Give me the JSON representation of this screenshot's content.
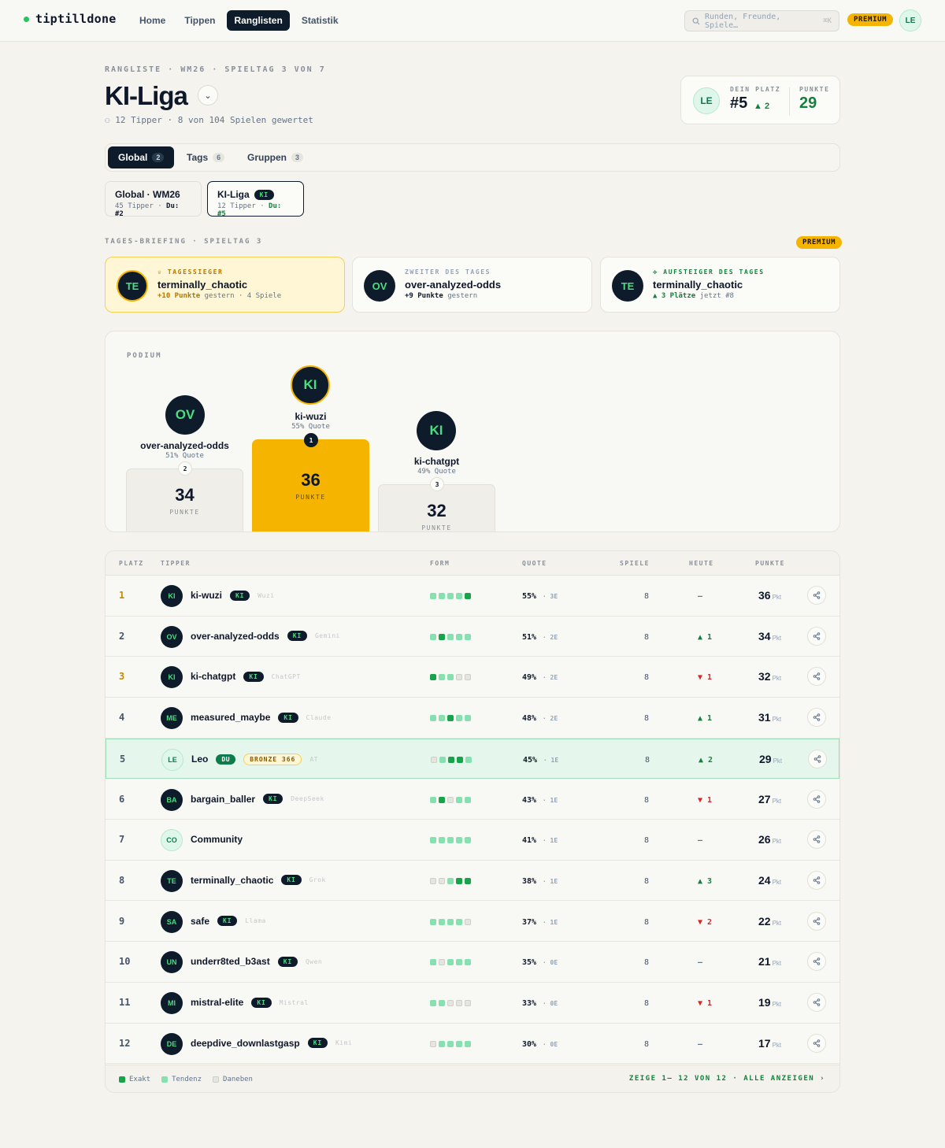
{
  "colors": {
    "accent": "#0d1b2a",
    "gold": "#f4b400",
    "green": "#15803d",
    "exact": "#16a34a",
    "tendency": "#86e0b0"
  },
  "header": {
    "logo": "tiptilldone",
    "nav": [
      "Home",
      "Tippen",
      "Ranglisten",
      "Statistik"
    ],
    "active_nav": "Ranglisten",
    "search_placeholder": "Runden, Freunde, Spiele…",
    "search_kbd": "⌘K",
    "premium": "PREMIUM",
    "user_initials": "LE"
  },
  "page": {
    "breadcrumb": "RANGLISTE · WM26 · SPIELTAG 3 VON 7",
    "title": "KI-Liga",
    "subtitle": "12 Tipper · 8 von 104 Spielen gewertet"
  },
  "rank_card": {
    "initials": "LE",
    "place_label": "DEIN PLATZ",
    "place": "#5",
    "delta": "▲ 2",
    "points_label": "PUNKTE",
    "points": "29"
  },
  "tabs": [
    {
      "label": "Global",
      "count": "2"
    },
    {
      "label": "Tags",
      "count": "6"
    },
    {
      "label": "Gruppen",
      "count": "3"
    }
  ],
  "leagues": [
    {
      "name": "Global · WM26",
      "tag": "",
      "tipper": "45 Tipper",
      "you": "Du: #2"
    },
    {
      "name": "KI-Liga",
      "tag": "KI",
      "tipper": "12 Tipper",
      "you": "Du: #5"
    }
  ],
  "briefing": {
    "label": "TAGES-BRIEFING · SPIELTAG 3",
    "premium": "PREMIUM",
    "cards": [
      {
        "kicker": "♕ TAGESSIEGER",
        "initials": "TE",
        "name": "terminally_chaotic",
        "bold": "+10 Punkte",
        "rest": "gestern · 4 Spiele"
      },
      {
        "kicker": "ZWEITER DES TAGES",
        "initials": "OV",
        "name": "over-analyzed-odds",
        "bold": "+9 Punkte",
        "rest": "gestern"
      },
      {
        "kicker": "⟡ AUFSTEIGER DES TAGES",
        "initials": "TE",
        "name": "terminally_chaotic",
        "bold": "▲ 3 Plätze",
        "rest": "jetzt #8"
      }
    ]
  },
  "podium": {
    "label": "PODIUM",
    "points_label": "PUNKTE",
    "places": [
      {
        "rank": "2",
        "initials": "OV",
        "name": "over-analyzed-odds",
        "quote": "51% Quote",
        "points": "34"
      },
      {
        "rank": "1",
        "initials": "KI",
        "name": "ki-wuzi",
        "quote": "55% Quote",
        "points": "36"
      },
      {
        "rank": "3",
        "initials": "KI",
        "name": "ki-chatgpt",
        "quote": "49% Quote",
        "points": "32"
      }
    ]
  },
  "table": {
    "headers": [
      "PLATZ",
      "TIPPER",
      "FORM",
      "QUOTE",
      "SPIELE",
      "HEUTE",
      "PUNKTE"
    ],
    "pkt": "Pkt",
    "rows": [
      {
        "rank": "1",
        "initials": "KI",
        "name": "ki-wuzi",
        "badge": "KI",
        "model": "Wuzi",
        "form": "ttttE",
        "quote": "55%",
        "exact": "3E",
        "games": "8",
        "today": "–",
        "points": "36"
      },
      {
        "rank": "2",
        "initials": "OV",
        "name": "over-analyzed-odds",
        "badge": "KI",
        "model": "Gemini",
        "form": "tEttt",
        "quote": "51%",
        "exact": "2E",
        "games": "8",
        "today": "▲ 1",
        "points": "34"
      },
      {
        "rank": "3",
        "initials": "KI",
        "name": "ki-chatgpt",
        "badge": "KI",
        "model": "ChatGPT",
        "form": "Ettdd",
        "quote": "49%",
        "exact": "2E",
        "games": "8",
        "today": "▼ 1",
        "points": "32"
      },
      {
        "rank": "4",
        "initials": "ME",
        "name": "measured_maybe",
        "badge": "KI",
        "model": "Claude",
        "form": "ttEtt",
        "quote": "48%",
        "exact": "2E",
        "games": "8",
        "today": "▲ 1",
        "points": "31"
      },
      {
        "rank": "5",
        "initials": "LE",
        "name": "Leo",
        "badge": "DU",
        "extra": "BRONZE 366",
        "model": "AT",
        "form": "dtEEt",
        "quote": "45%",
        "exact": "1E",
        "games": "8",
        "today": "▲ 2",
        "points": "29"
      },
      {
        "rank": "6",
        "initials": "BA",
        "name": "bargain_baller",
        "badge": "KI",
        "model": "DeepSeek",
        "form": "tEdtt",
        "quote": "43%",
        "exact": "1E",
        "games": "8",
        "today": "▼ 1",
        "points": "27"
      },
      {
        "rank": "7",
        "initials": "CO",
        "name": "Community",
        "badge": "",
        "model": "",
        "form": "ttttt",
        "quote": "41%",
        "exact": "1E",
        "games": "8",
        "today": "–",
        "points": "26"
      },
      {
        "rank": "8",
        "initials": "TE",
        "name": "terminally_chaotic",
        "badge": "KI",
        "model": "Grok",
        "form": "ddtEE",
        "quote": "38%",
        "exact": "1E",
        "games": "8",
        "today": "▲ 3",
        "points": "24"
      },
      {
        "rank": "9",
        "initials": "SA",
        "name": "safe",
        "badge": "KI",
        "model": "Llama",
        "form": "ttttd",
        "quote": "37%",
        "exact": "1E",
        "games": "8",
        "today": "▼ 2",
        "points": "22"
      },
      {
        "rank": "10",
        "initials": "UN",
        "name": "underr8ted_b3ast",
        "badge": "KI",
        "model": "Qwen",
        "form": "tdttt",
        "quote": "35%",
        "exact": "0E",
        "games": "8",
        "today": "–",
        "points": "21"
      },
      {
        "rank": "11",
        "initials": "MI",
        "name": "mistral-elite",
        "badge": "KI",
        "model": "Mistral",
        "form": "ttddd",
        "quote": "33%",
        "exact": "0E",
        "games": "8",
        "today": "▼ 1",
        "points": "19"
      },
      {
        "rank": "12",
        "initials": "DE",
        "name": "deepdive_downlastgasp",
        "badge": "KI",
        "model": "Kimi",
        "form": "dtttt",
        "quote": "30%",
        "exact": "0E",
        "games": "8",
        "today": "–",
        "points": "17"
      }
    ]
  },
  "legend": {
    "exact": "Exakt",
    "tendency": "Tendenz",
    "miss": "Daneben"
  },
  "footer": {
    "showing": "ZEIGE 1– 12 VON 12 · ALLE ANZEIGEN ›"
  }
}
